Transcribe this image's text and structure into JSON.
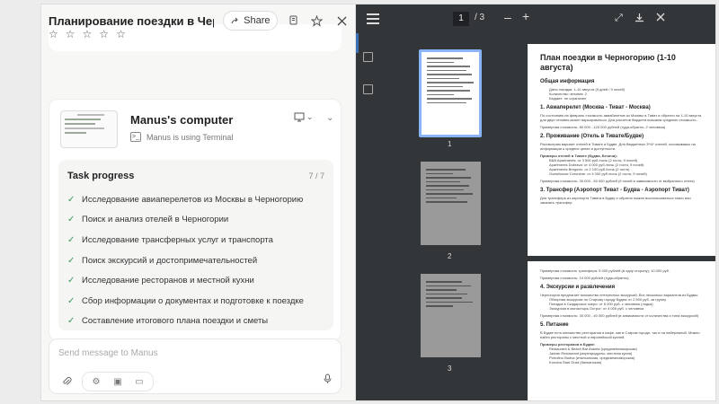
{
  "header": {
    "title": "Планирование поездки в Черногор...",
    "share_label": "Share"
  },
  "rating": {
    "stars": 5
  },
  "computer": {
    "name": "Manus's computer",
    "status": "Manus is using Terminal"
  },
  "task_progress": {
    "title": "Task progress",
    "count": "7 / 7",
    "items": [
      "Исследование авиаперелетов из Москвы в Черногорию",
      "Поиск и анализ отелей в Черногории",
      "Исследование трансферных услуг и транспорта",
      "Поиск экскурсий и достопримечательностей",
      "Исследование ресторанов и местной кухни",
      "Сбор информации о документах и подготовке к поездке",
      "Составление итогового плана поездки и сметы"
    ]
  },
  "composer": {
    "placeholder": "Send message to Manus"
  },
  "viewer": {
    "current_page": "1",
    "total_pages": "/ 3",
    "thumb_labels": [
      "1",
      "2",
      "3"
    ],
    "page1": {
      "title": "План поездки в Черногорию (1-10 августа)",
      "h_general": "Общая информация",
      "general_items": [
        "Даты поездки: 1-10 августа (9 дней / 9 ночей)",
        "Количество человек: 2",
        "Бюджет: не ограничен"
      ],
      "h_avia": "1. Авиаперелет (Москва - Тиват - Москва)",
      "avia_text": "По состоянию на февраль стоимость авиабилетов из Москвы в Тиват и обратно на 1-10 августа для двух человек может варьироваться. Для расчетов бюджета возьмем среднюю стоимость.",
      "avia_cost": "Примерная стоимость: 80 000 - 120 000 рублей (туда-обратно, 2 человека)",
      "h_hotel": "2. Проживание (Отель в Тивате/Будве)",
      "hotel_text": "Рассмотрим вариант отелей в Тивате и Будве. Для бюджетных 3*/4* отелей, основываясь на информации о средних ценах и доступности.",
      "hotel_sub": "Примеры отелей в Тивате (Будва, Бечичи):",
      "hotel_items": [
        "B&B Apartments: от 3 500 руб./ночь (2 гостя, 9 ночей)",
        "Apartments Dubrava: от 4 000 руб./ночь (2 гостя, 9 ночей)",
        "Apartments Bregovic: от 2 100 руб./ночь (2 гостя)",
        "Guesthouse Ceronime: от 4 000 руб./ночь (2 гостя, 9 ночей)"
      ],
      "hotel_cost": "Примерная стоимость: 30 000 - 50 000 рублей (9 ночей в зависимости от выбранного отеля)",
      "h_transfer": "3. Трансфер (Аэропорт Тиват - Будва - Аэропорт Тиват)",
      "transfer_text": "Для трансфера из аэропорта Тивата в Будву и обратно можно воспользоваться такси или заказать трансфер."
    },
    "page2": {
      "transfer_cost": "Примерная стоимость трансфера: 5 000 рублей (в одну сторону); 10 000 руб.",
      "transfer_total": "Примерная стоимость: 10 000 рублей (туда-обратно)",
      "h_tours": "4. Экскурсии и развлечения",
      "tours_text": "Черногория предлагает множество интересных экскурсий. Вот несколько вариантов из Будвы:",
      "tour_items": [
        "Обзорная экскурсия по Старому городу Будва: от 2 500 руб. за группу",
        "Поездка в Скадарское озеро: от 6 000 руб. с человека (лодка)",
        "Экскурсия в монастырь Острог: от 4 000 руб. с человека"
      ],
      "tours_cost": "Примерная стоимость: 30 000 - 40 000 рублей (в зависимости от количества и типа экскурсий)",
      "h_food": "5. Питание",
      "food_text": "В Будве есть множество ресторанов и кафе, как в Старом городе, так и на набережной. Можно найти рестораны с местной и европейской кухней.",
      "food_sub": "Примеры ресторанов в Будве:",
      "food_items": [
        "Restaurant & Beach Bar Astoria (средиземноморская)",
        "Jadran Restaurant (морепродукты, местная кухня)",
        "Portofino Budva (итальянская, средиземноморская)",
        "Konoba Stari Grad (балканская)"
      ]
    }
  }
}
